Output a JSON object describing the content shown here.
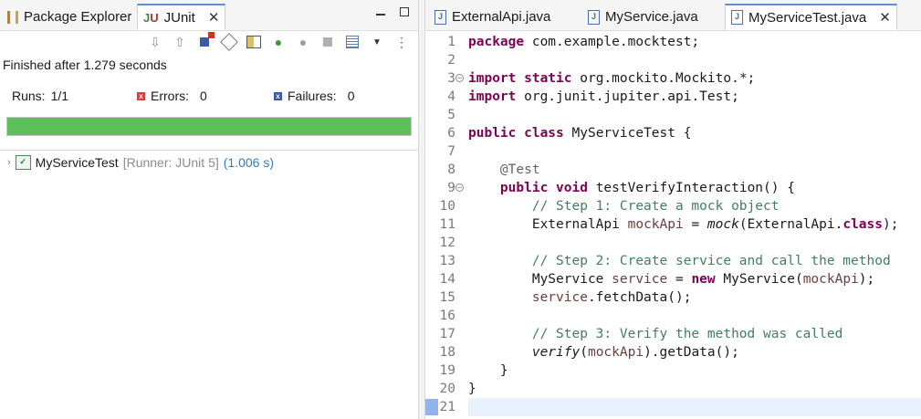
{
  "left": {
    "tabs": [
      {
        "label": "Package Explorer",
        "icon": "package-explorer-icon"
      },
      {
        "label": "JUnit",
        "icon": "junit-icon"
      }
    ],
    "status": "Finished after 1.279 seconds",
    "runs_label": "Runs:",
    "runs_value": "1/1",
    "errors_label": "Errors:",
    "errors_value": "0",
    "failures_label": "Failures:",
    "failures_value": "0",
    "progress": 1.0,
    "progress_color": "#5cbf5c",
    "tree": {
      "name": "MyServiceTest",
      "runner": "[Runner: JUnit 5]",
      "time": "(1.006 s)"
    }
  },
  "editor": {
    "tabs": [
      {
        "label": "ExternalApi.java"
      },
      {
        "label": "MyService.java"
      },
      {
        "label": "MyServiceTest.java"
      }
    ],
    "line_numbers": [
      "1",
      "2",
      "3",
      "4",
      "5",
      "6",
      "7",
      "8",
      "9",
      "10",
      "11",
      "12",
      "13",
      "14",
      "15",
      "16",
      "17",
      "18",
      "19",
      "20",
      "21"
    ],
    "tokens": {
      "l1_kw": "package",
      "l1_rest": " com.example.mocktest;",
      "l3_kw1": "import",
      "l3_kw2": " static",
      "l3_rest": " org.mockito.Mockito.*;",
      "l4_kw": "import",
      "l4_rest": " org.junit.jupiter.api.Test;",
      "l6_kw1": "public",
      "l6_kw2": " class",
      "l6_rest": " MyServiceTest {",
      "l8_an": "    @Test",
      "l9_kw1": "    public",
      "l9_kw2": " void",
      "l9_rest": " testVerifyInteraction() {",
      "l10_cm": "        // Step 1: Create a mock object",
      "l11_a": "        ExternalApi ",
      "l11_fld": "mockApi",
      "l11_b": " = ",
      "l11_it": "mock",
      "l11_c": "(ExternalApi.",
      "l11_kw": "class",
      "l11_d": ");",
      "l13_cm": "        // Step 2: Create service and call the method",
      "l14_a": "        MyService ",
      "l14_fld": "service",
      "l14_b": " = ",
      "l14_kw": "new",
      "l14_c": " MyService(",
      "l14_fld2": "mockApi",
      "l14_d": ");",
      "l15_indent": "        ",
      "l15_fld": "service",
      "l15_rest": ".fetchData();",
      "l17_cm": "        // Step 3: Verify the method was called",
      "l18_indent": "        ",
      "l18_it": "verify",
      "l18_b": "(",
      "l18_fld": "mockApi",
      "l18_c": ").getData();",
      "l19": "    }",
      "l20": "}"
    }
  }
}
